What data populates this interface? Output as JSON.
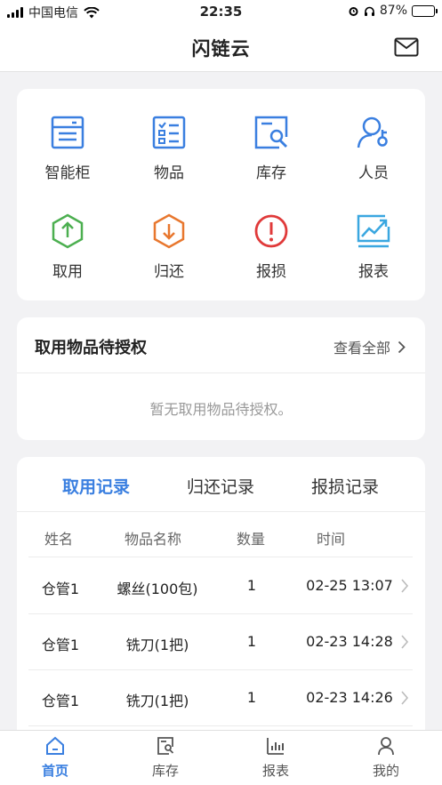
{
  "status_bar": {
    "carrier": "中国电信",
    "time": "22:35",
    "battery": "87%",
    "battery_level": 0.87
  },
  "header": {
    "title": "闪链云",
    "mail_icon": "mail-icon"
  },
  "grid": [
    {
      "label": "智能柜",
      "icon": "cabinet-icon",
      "color": "#3a7fe0"
    },
    {
      "label": "物品",
      "icon": "item-list-icon",
      "color": "#3a7fe0"
    },
    {
      "label": "库存",
      "icon": "inventory-search-icon",
      "color": "#3a7fe0"
    },
    {
      "label": "人员",
      "icon": "person-key-icon",
      "color": "#3a7fe0"
    },
    {
      "label": "取用",
      "icon": "take-out-icon",
      "color": "#4caf50"
    },
    {
      "label": "归还",
      "icon": "return-icon",
      "color": "#e8772e"
    },
    {
      "label": "报损",
      "icon": "alert-icon",
      "color": "#e03a3a"
    },
    {
      "label": "报表",
      "icon": "chart-icon",
      "color": "#3aa7e0"
    }
  ],
  "pending": {
    "title": "取用物品待授权",
    "view_all": "查看全部",
    "empty_text": "暂无取用物品待授权。"
  },
  "records": {
    "tabs": [
      "取用记录",
      "归还记录",
      "报损记录"
    ],
    "active_tab": 0,
    "columns": [
      "姓名",
      "物品名称",
      "数量",
      "时间"
    ],
    "rows": [
      {
        "name": "仓管1",
        "item": "螺丝(100包)",
        "qty": "1",
        "time": "02-25 13:07"
      },
      {
        "name": "仓管1",
        "item": "铣刀(1把)",
        "qty": "1",
        "time": "02-23 14:28"
      },
      {
        "name": "仓管1",
        "item": "铣刀(1把)",
        "qty": "1",
        "time": "02-23 14:26"
      }
    ]
  },
  "tabbar": [
    {
      "label": "首页",
      "icon": "home-icon",
      "active": true
    },
    {
      "label": "库存",
      "icon": "inventory-icon",
      "active": false
    },
    {
      "label": "报表",
      "icon": "report-icon",
      "active": false
    },
    {
      "label": "我的",
      "icon": "profile-icon",
      "active": false
    }
  ],
  "colors": {
    "accent": "#3a7fe0",
    "background": "#f2f2f4"
  }
}
